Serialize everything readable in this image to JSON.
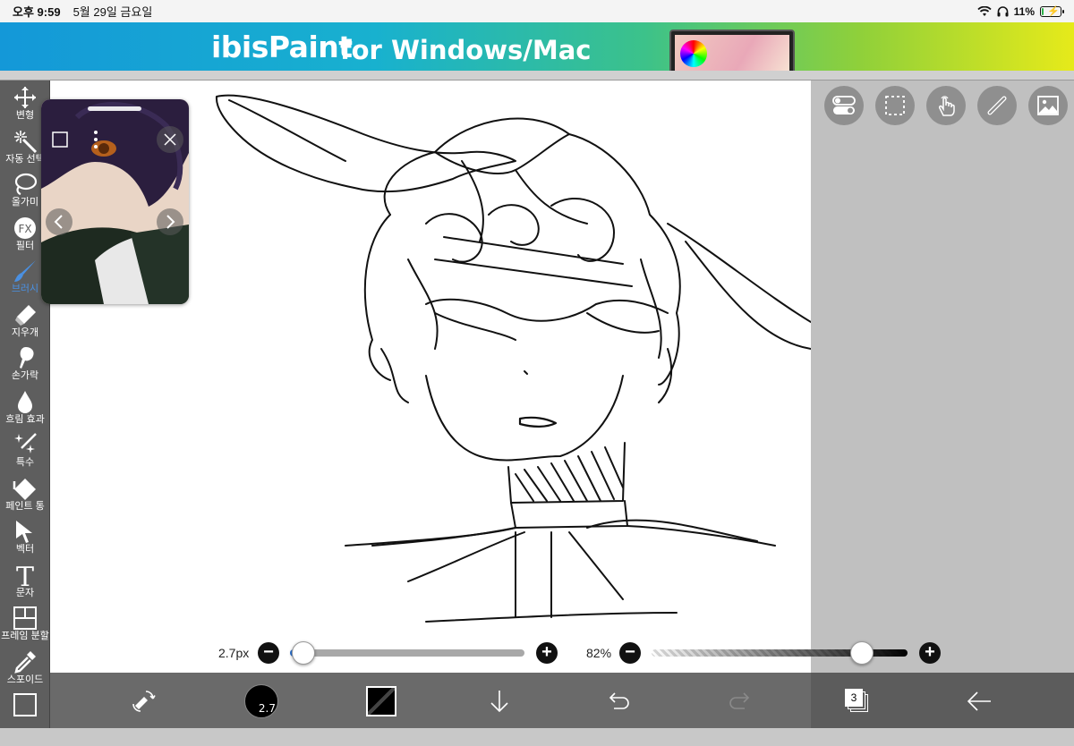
{
  "status_bar": {
    "time": "오후 9:59",
    "date": "5월 29일 금요일",
    "battery": "11%",
    "battery_level": 0.11
  },
  "ad": {
    "brand": "ibisPaint",
    "slogan": "for Windows/Mac"
  },
  "tools": [
    {
      "label": "변형",
      "icon": "move-icon"
    },
    {
      "label": "자동 선택",
      "icon": "magic-wand-icon"
    },
    {
      "label": "올가미",
      "icon": "lasso-icon"
    },
    {
      "label": "필터",
      "icon": "fx-icon",
      "icon_text": "FX"
    },
    {
      "label": "브러시",
      "icon": "brush-icon",
      "active": true
    },
    {
      "label": "지우개",
      "icon": "eraser-icon"
    },
    {
      "label": "손가락",
      "icon": "finger-icon"
    },
    {
      "label": "흐림 효과",
      "icon": "blur-drop-icon"
    },
    {
      "label": "특수",
      "icon": "special-sparkle-icon"
    },
    {
      "label": "페인트 통",
      "icon": "paint-bucket-icon"
    },
    {
      "label": "벡터",
      "icon": "vector-arrow-icon"
    },
    {
      "label": "문자",
      "icon": "text-icon",
      "icon_text": "T"
    },
    {
      "label": "프레임 분할",
      "icon": "frame-divide-icon"
    },
    {
      "label": "스포이드",
      "icon": "eyedropper-icon"
    },
    {
      "label": "",
      "icon": "canvas-icon"
    }
  ],
  "brush_size": {
    "value_label": "2.7px",
    "badge": "2.7",
    "minus": "−",
    "plus": "+"
  },
  "opacity": {
    "value_label": "82%",
    "level": 0.82,
    "minus": "−",
    "plus": "+"
  },
  "layers": {
    "count": "3"
  },
  "colors": {
    "primary": "#000000",
    "accent": "#4a90e2"
  }
}
